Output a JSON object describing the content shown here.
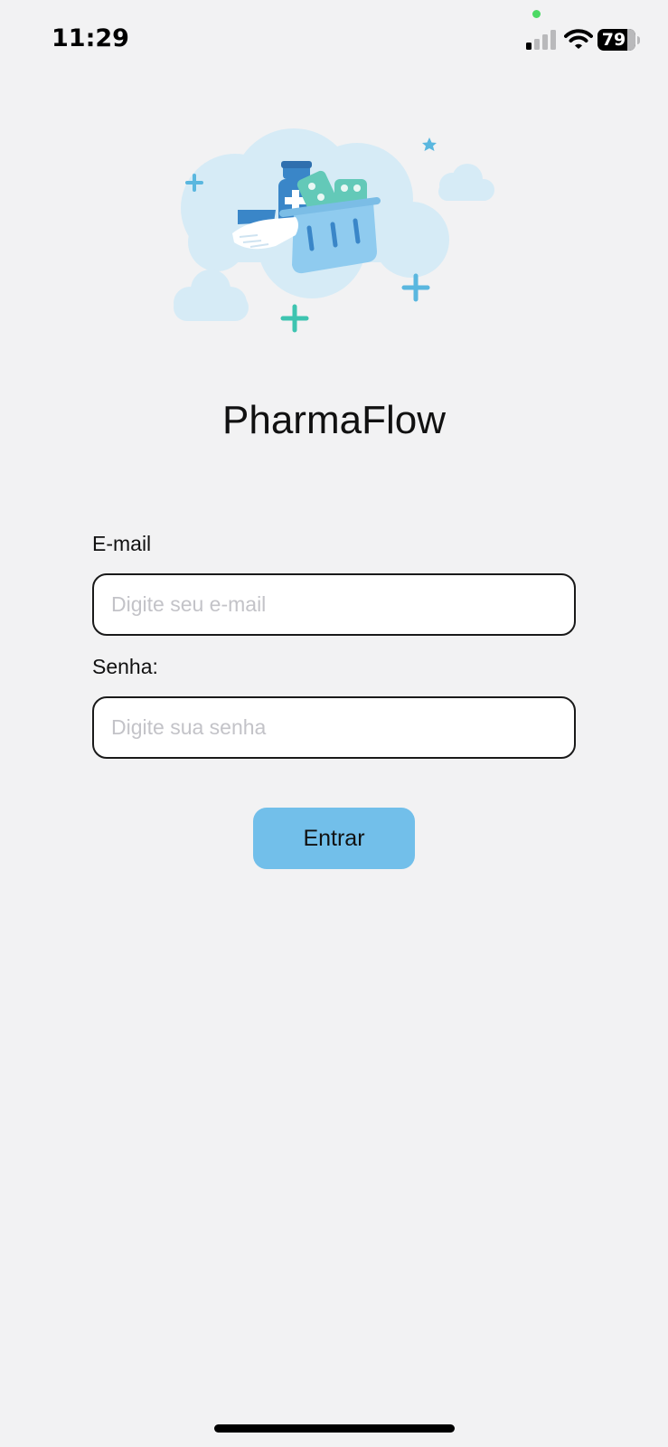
{
  "status_bar": {
    "time": "11:29",
    "battery_level": "79",
    "battery_percent": 79,
    "privacy_indicator_color": "#4cd964"
  },
  "hero": {
    "icon": "pharmacy-basket-illustration"
  },
  "app": {
    "title": "PharmaFlow"
  },
  "form": {
    "email_label": "E-mail",
    "email_placeholder": "Digite seu e-mail",
    "email_value": "",
    "password_label": "Senha:",
    "password_placeholder": "Digite sua senha",
    "password_value": "",
    "submit_label": "Entrar"
  },
  "colors": {
    "background": "#f2f2f3",
    "accent": "#72bfea",
    "cloud": "#d6ebf6",
    "teal": "#3ec4b0",
    "bottle_blue": "#3a86c8"
  }
}
